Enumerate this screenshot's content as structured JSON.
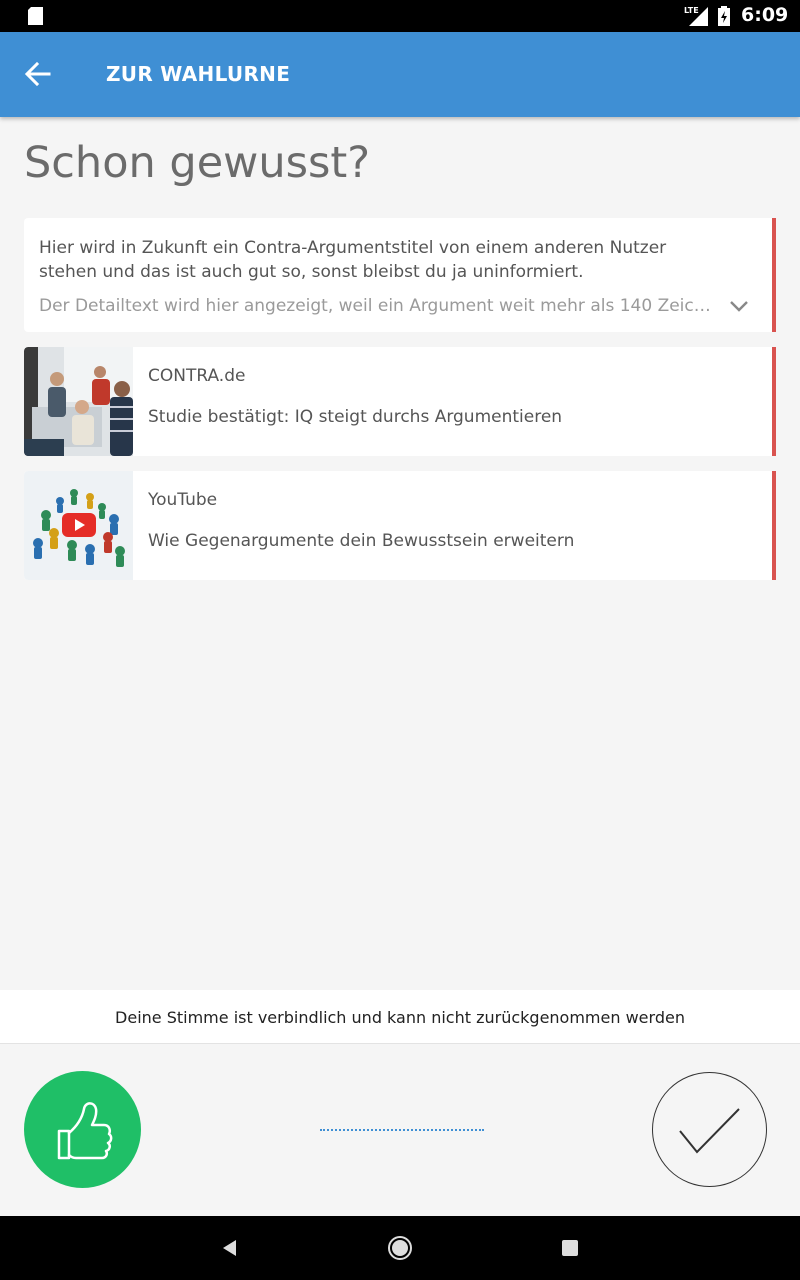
{
  "status_bar": {
    "network_label": "LTE",
    "time": "6:09"
  },
  "app_bar": {
    "title": "ZUR WAHLURNE",
    "back_icon": "arrow-left-icon"
  },
  "heading": "Schon gewusst?",
  "argument": {
    "title": "Hier wird in Zukunft ein Contra-Argumentstitel von einem anderen Nutzer stehen und das ist auch gut so, sonst bleibst du ja uninformiert.",
    "detail": "Der Detailtext wird hier angezeigt, weil ein Argument weit mehr als 140 Zeiche…",
    "expand_icon": "chevron-down-icon"
  },
  "links": [
    {
      "source": "CONTRA.de",
      "headline": "Studie bestätigt: IQ steigt durchs Argumentieren",
      "thumb": "meeting-photo"
    },
    {
      "source": "YouTube",
      "headline": "Wie Gegenargumente dein Bewusstsein erweitern",
      "thumb": "video-thumbnail"
    }
  ],
  "notice": "Deine Stimme ist verbindlich und kann nicht zurückgenommen werden",
  "vote": {
    "thumb_icon": "thumbs-up-icon",
    "confirm_icon": "check-icon"
  },
  "colors": {
    "app_bar": "#3f8fd4",
    "accent_red": "#d9534f",
    "vote_green": "#1fbf67"
  }
}
